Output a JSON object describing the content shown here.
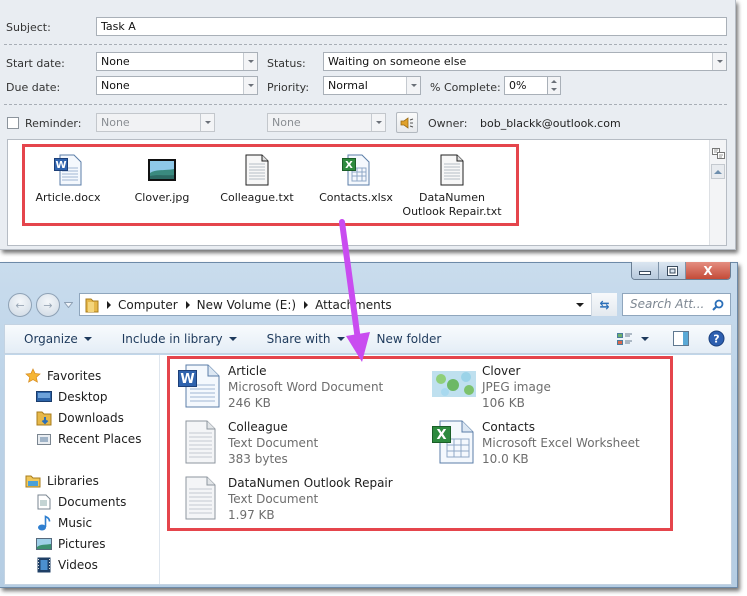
{
  "outlook_task": {
    "subject_label": "Subject:",
    "subject_value": "Task A",
    "start_date_label": "Start date:",
    "start_date_value": "None",
    "due_date_label": "Due date:",
    "due_date_value": "None",
    "status_label": "Status:",
    "status_value": "Waiting on someone else",
    "priority_label": "Priority:",
    "priority_value": "Normal",
    "percent_complete_label": "% Complete:",
    "percent_complete_value": "0%",
    "reminder_label": "Reminder:",
    "reminder_checked": false,
    "reminder_date_value": "None",
    "reminder_time_value": "None",
    "owner_label": "Owner:",
    "owner_value": "bob_blackk@outlook.com",
    "attachments": [
      {
        "name": "Article.docx",
        "icon": "word-document-icon"
      },
      {
        "name": "Clover.jpg",
        "icon": "image-file-icon"
      },
      {
        "name": "Colleague.txt",
        "icon": "text-file-icon"
      },
      {
        "name": "Contacts.xlsx",
        "icon": "excel-file-icon"
      },
      {
        "name_line1": "DataNumen",
        "name_line2": "Outlook Repair.txt",
        "icon": "text-file-icon"
      }
    ]
  },
  "explorer": {
    "window_buttons": {
      "minimize": "—",
      "maximize": "□",
      "close": "X"
    },
    "breadcrumb": [
      "Computer",
      "New Volume (E:)",
      "Attachments"
    ],
    "search_placeholder": "Search Att...",
    "toolbar": {
      "organize": "Organize",
      "include_in_library": "Include in library",
      "share_with": "Share with",
      "new_folder": "New folder"
    },
    "nav": {
      "favorites_header": "Favorites",
      "favorites": [
        "Desktop",
        "Downloads",
        "Recent Places"
      ],
      "libraries_header": "Libraries",
      "libraries": [
        "Documents",
        "Music",
        "Pictures",
        "Videos"
      ]
    },
    "files": [
      {
        "name": "Article",
        "type": "Microsoft Word Document",
        "size": "246 KB",
        "icon": "word-document-icon"
      },
      {
        "name": "Clover",
        "type": "JPEG image",
        "size": "106 KB",
        "icon": "image-thumbnail-icon"
      },
      {
        "name": "Colleague",
        "type": "Text Document",
        "size": "383 bytes",
        "icon": "text-file-icon"
      },
      {
        "name": "Contacts",
        "type": "Microsoft Excel Worksheet",
        "size": "10.0 KB",
        "icon": "excel-file-icon"
      },
      {
        "name": "DataNumen Outlook Repair",
        "type": "Text Document",
        "size": "1.97 KB",
        "icon": "text-file-icon"
      }
    ]
  },
  "annotation": {
    "highlight_color": "#e5454c",
    "arrow_color": "#c94cf0"
  }
}
